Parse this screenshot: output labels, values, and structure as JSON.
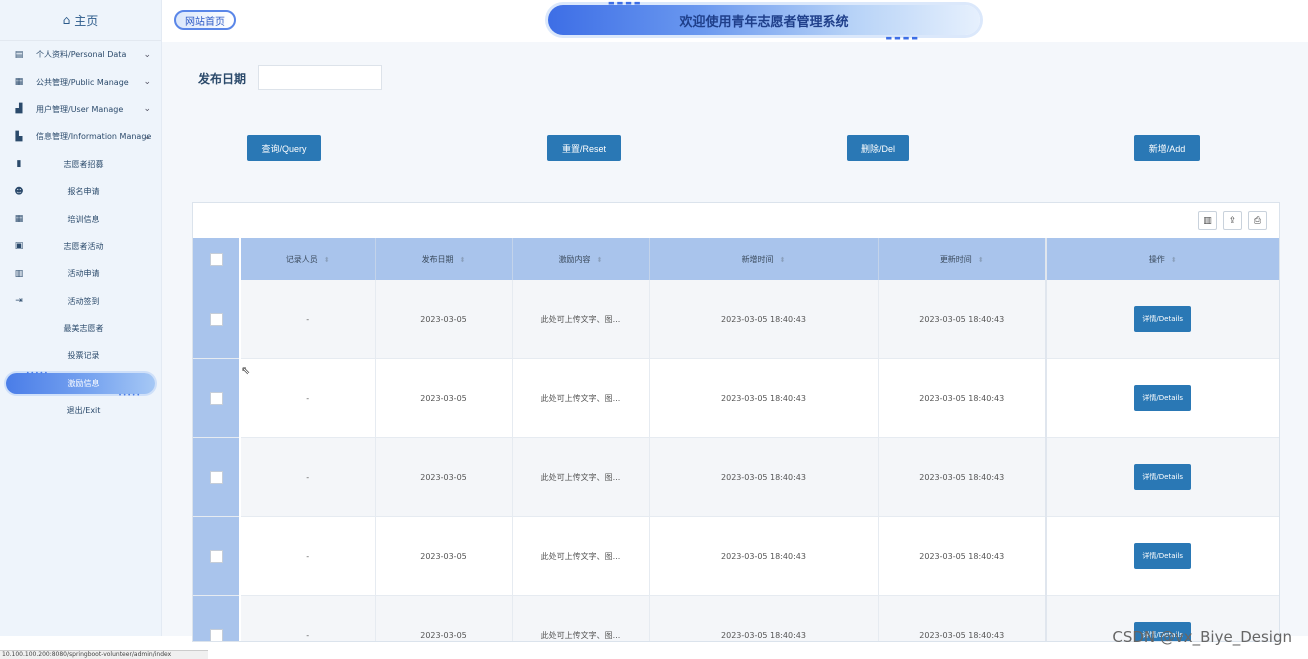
{
  "sidebar": {
    "home": "主页",
    "items": [
      {
        "label": "个人资料/Personal Data",
        "icon": "document-icon",
        "group": true
      },
      {
        "label": "公共管理/Public Manage",
        "icon": "clipboard-icon",
        "group": true
      },
      {
        "label": "用户管理/User Manage",
        "icon": "chart-icon",
        "group": true
      },
      {
        "label": "信息管理/Information Manage",
        "icon": "building-icon",
        "group": true
      },
      {
        "label": "志愿者招募",
        "icon": "bookmark-icon"
      },
      {
        "label": "报名申请",
        "icon": "user-icon"
      },
      {
        "label": "培训信息",
        "icon": "calendar-icon"
      },
      {
        "label": "志愿者活动",
        "icon": "calendar-check-icon"
      },
      {
        "label": "活动申请",
        "icon": "book-icon"
      },
      {
        "label": "活动签到",
        "icon": "signin-icon"
      },
      {
        "label": "最美志愿者",
        "icon": ""
      },
      {
        "label": "投票记录",
        "icon": ""
      },
      {
        "label": "激励信息",
        "icon": "",
        "active": true
      },
      {
        "label": "退出/Exit",
        "icon": ""
      }
    ]
  },
  "header": {
    "site_home": "网站首页",
    "title": "欢迎使用青年志愿者管理系统"
  },
  "filter": {
    "label": "发布日期",
    "value": ""
  },
  "buttons": {
    "query": "查询/Query",
    "reset": "重置/Reset",
    "delete": "删除/Del",
    "add": "新增/Add"
  },
  "table": {
    "columns": [
      "记录人员",
      "发布日期",
      "激励内容",
      "新增时间",
      "更新时间",
      "操作"
    ],
    "detail_label": "详情/Details",
    "rows": [
      {
        "recorder": "-",
        "date": "2023-03-05",
        "content": "此处可上传文字、图...",
        "created": "2023-03-05 18:40:43",
        "updated": "2023-03-05 18:40:43"
      },
      {
        "recorder": "-",
        "date": "2023-03-05",
        "content": "此处可上传文字、图...",
        "created": "2023-03-05 18:40:43",
        "updated": "2023-03-05 18:40:43"
      },
      {
        "recorder": "-",
        "date": "2023-03-05",
        "content": "此处可上传文字、图...",
        "created": "2023-03-05 18:40:43",
        "updated": "2023-03-05 18:40:43"
      },
      {
        "recorder": "-",
        "date": "2023-03-05",
        "content": "此处可上传文字、图...",
        "created": "2023-03-05 18:40:43",
        "updated": "2023-03-05 18:40:43"
      },
      {
        "recorder": "-",
        "date": "2023-03-05",
        "content": "此处可上传文字、图...",
        "created": "2023-03-05 18:40:43",
        "updated": "2023-03-05 18:40:43"
      }
    ]
  },
  "statusbar": "10.100.100.200:8080/springboot-volunteer/admin/index",
  "watermark": "CSDN @vx_Biye_Design",
  "colors": {
    "primary_button": "#2a78b5",
    "table_header": "#a9c4ec",
    "sidebar_bg": "#eef4fb"
  }
}
